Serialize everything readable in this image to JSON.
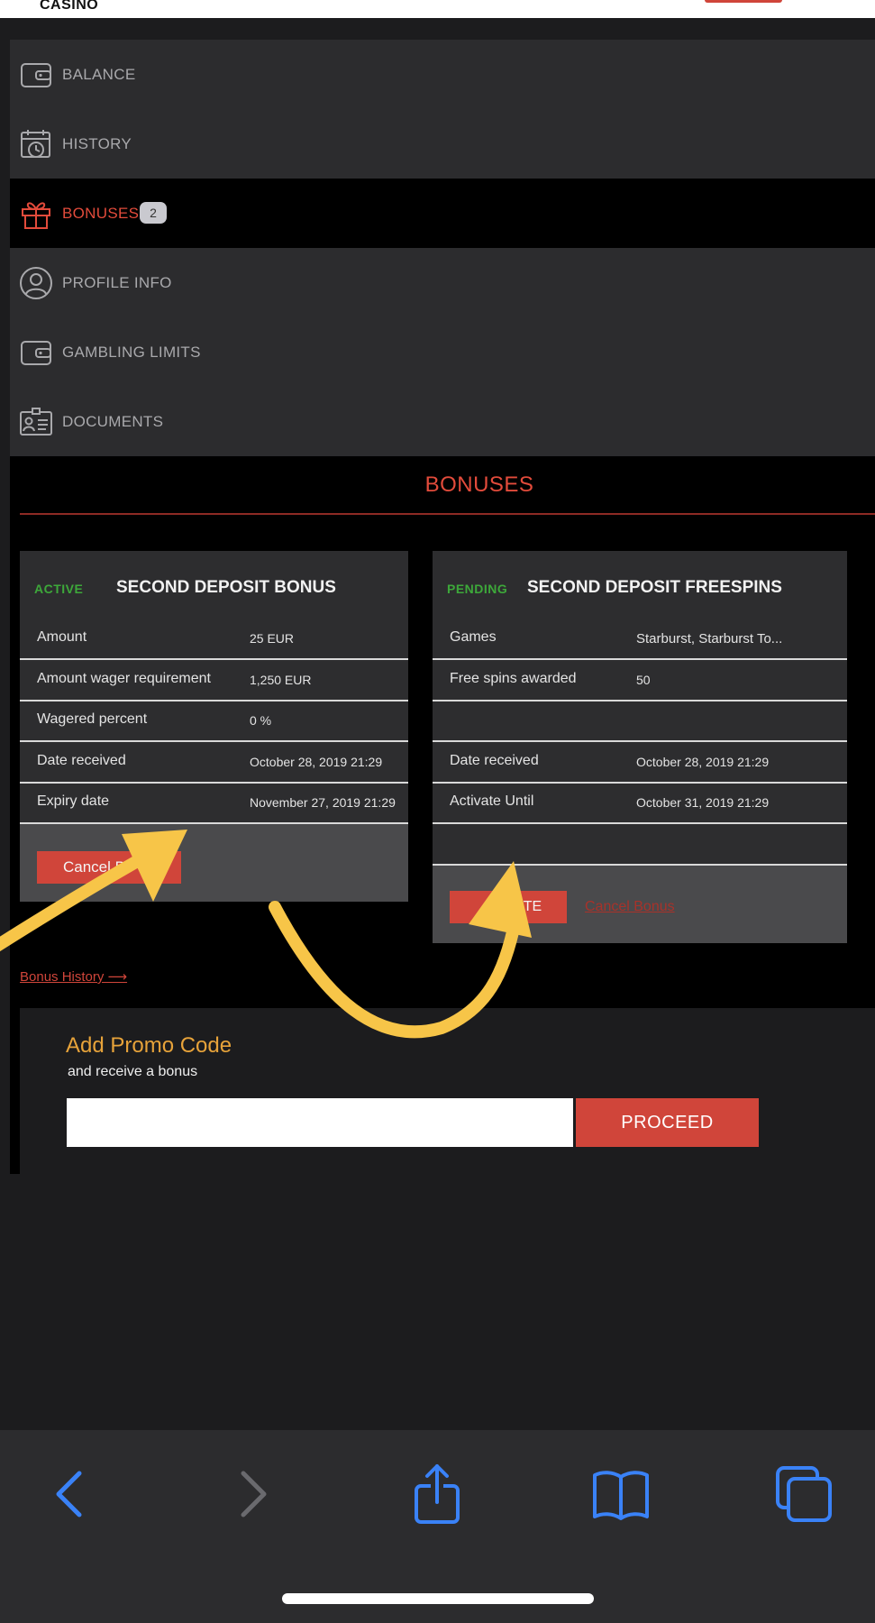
{
  "header": {
    "logo_text": "CASINO"
  },
  "nav": {
    "items": [
      {
        "label": "BALANCE",
        "icon": "wallet-icon"
      },
      {
        "label": "HISTORY",
        "icon": "calendar-clock-icon"
      },
      {
        "label": "BONUSES",
        "icon": "gift-icon",
        "badge": "2",
        "active": true
      },
      {
        "label": "PROFILE INFO",
        "icon": "user-icon"
      },
      {
        "label": "GAMBLING LIMITS",
        "icon": "wallet-icon"
      },
      {
        "label": "DOCUMENTS",
        "icon": "id-card-icon"
      }
    ]
  },
  "section_title": "BONUSES",
  "cards": [
    {
      "status": "ACTIVE",
      "title": "SECOND DEPOSIT BONUS",
      "rows": [
        {
          "label": "Amount",
          "value": "25 EUR"
        },
        {
          "label": "Amount wager requirement",
          "value": "1,250 EUR"
        },
        {
          "label": "Wagered percent",
          "value": "0 %"
        },
        {
          "label": "Date received",
          "value": "October 28, 2019 21:29"
        },
        {
          "label": "Expiry date",
          "value": "November 27, 2019 21:29"
        }
      ],
      "button_label": "Cancel Bo"
    },
    {
      "status": "PENDING",
      "title": "SECOND DEPOSIT FREESPINS",
      "rows": [
        {
          "label": "Games",
          "value": "Starburst, Starburst To..."
        },
        {
          "label": "Free spins awarded",
          "value": "50"
        },
        {
          "label": "",
          "value": ""
        },
        {
          "label": "Date received",
          "value": "October 28, 2019 21:29"
        },
        {
          "label": "Activate Until",
          "value": "October 31, 2019 21:29"
        }
      ],
      "button_label": "TE",
      "link_label": "Cancel Bonus"
    }
  ],
  "bonus_history_link": "Bonus History ⟶",
  "promo": {
    "title": "Add Promo Code",
    "subtitle": "and receive a bonus",
    "input_value": "",
    "button_label": "PROCEED"
  },
  "colors": {
    "accent_red": "#d0453a",
    "active_green": "#3da83a",
    "promo_orange": "#e7a33a",
    "arrow_yellow": "#f7c548",
    "ios_blue": "#3a82f7"
  },
  "toolbar": {
    "icons": [
      "back-icon",
      "forward-icon",
      "share-icon",
      "bookmarks-icon",
      "tabs-icon"
    ]
  }
}
